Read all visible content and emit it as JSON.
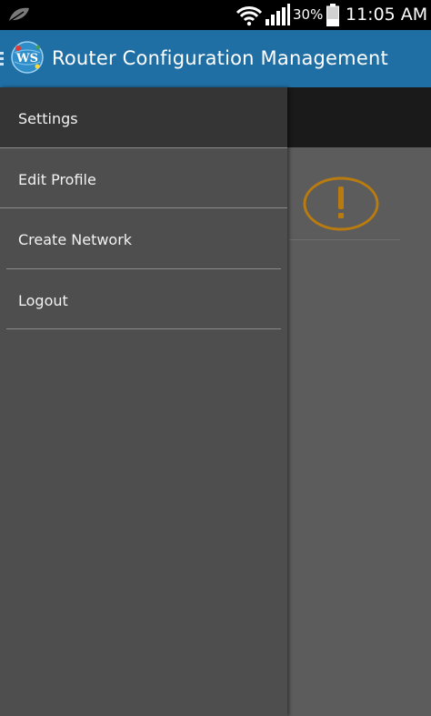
{
  "status_bar": {
    "battery_percent": "30%",
    "time": "11:05 AM",
    "icons": [
      "leaf-icon",
      "wifi-icon",
      "signal-icon",
      "battery-icon"
    ]
  },
  "app_bar": {
    "logo_text": "WS",
    "title": "Router Configuration Management",
    "color": "#1f6fa5"
  },
  "drawer": {
    "items": [
      {
        "label": "Settings",
        "active": true
      },
      {
        "label": "Edit Profile",
        "active": false
      },
      {
        "label": "Create Network",
        "active": false
      },
      {
        "label": "Logout",
        "active": false
      }
    ]
  },
  "main": {
    "icons": [
      "alert-icon"
    ],
    "alert_color": "#c8860a"
  }
}
